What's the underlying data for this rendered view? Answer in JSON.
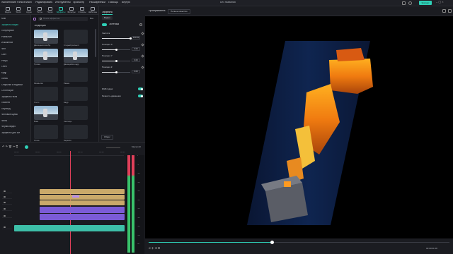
{
  "app": {
    "title": "Без названия",
    "menu": [
      "Wondershare Filmora",
      "Файл",
      "Редактировать",
      "Инструменты",
      "Просмотр",
      "Расширенный",
      "Помощь",
      "Внутри"
    ],
    "export_button": "Экспорт",
    "colors": {
      "accent": "#2fd0b7",
      "audio_green": "#39c26b",
      "audio_red": "#e0405a",
      "clip_gold": "#c9a96a",
      "clip_purple": "#7b5bd6",
      "clip_teal": "#3dbfa8"
    }
  },
  "toolbar": {
    "items": [
      {
        "label": "Медиа",
        "icon": "media-icon"
      },
      {
        "label": "Stock",
        "icon": "stock-icon"
      },
      {
        "label": "Аудио",
        "icon": "audio-icon"
      },
      {
        "label": "Титры",
        "icon": "titles-icon"
      },
      {
        "label": "Перех.",
        "icon": "transition-icon"
      },
      {
        "label": "Эффекты",
        "icon": "effects-icon"
      },
      {
        "label": "Фильтры",
        "icon": "filters-icon"
      },
      {
        "label": "Стикеры",
        "icon": "stickers-icon"
      },
      {
        "label": "Шаблоны",
        "icon": "templates-icon"
      }
    ],
    "active_index": 5
  },
  "categories": {
    "items": [
      "Мои",
      "Эффекты видео",
      "Популярное",
      "Размытие",
      "Искажение",
      "Фон",
      "Свет",
      "Ретро",
      "Глитч",
      "Кадр",
      "Линзы",
      "Открытки и подписи",
      "Сплитскрин",
      "Эффекты тела",
      "Пиксели",
      "Переход",
      "Фоновые шумы",
      "Фоны",
      "Формы видео",
      "Эффекты для ИИ"
    ],
    "selected_index": 1
  },
  "effects": {
    "search_placeholder": "Поиск эффектов",
    "filter_label": "Все",
    "section_title": "Тенденции",
    "items": [
      {
        "label": "Двоящееся изобр.",
        "thumb": "light"
      },
      {
        "label": "Старый фильм 2",
        "thumb": "dark"
      },
      {
        "label": "Тряска",
        "thumb": "light"
      },
      {
        "label": "Двоящийся кадр",
        "thumb": "light"
      },
      {
        "label": "Размытие",
        "thumb": "dark"
      },
      {
        "label": "Рамка",
        "thumb": "dark"
      },
      {
        "label": "Глитч",
        "thumb": "dark"
      },
      {
        "label": "Кадр",
        "thumb": "dark"
      },
      {
        "label": "Боке",
        "thumb": "light"
      },
      {
        "label": "Частицы",
        "thumb": "dark"
      },
      {
        "label": "Огонь",
        "thumb": "dark"
      },
      {
        "label": "Зеркало",
        "thumb": "dark"
      }
    ]
  },
  "properties": {
    "tab": "Эффекты",
    "subtab": "Видео",
    "effect_name": "Эстетика",
    "params": [
      {
        "label": "Частота",
        "value": "100.00",
        "fraction": 1.0
      },
      {
        "label": "Позиция X",
        "value": "0.00",
        "fraction": 0.5
      },
      {
        "label": "Позиция Y",
        "value": "0.00",
        "fraction": 0.5
      },
      {
        "label": "Позиция Z",
        "value": "0.00",
        "fraction": 0.5
      }
    ],
    "toggle1_label": "RGB Сдвиг",
    "toggle2_label": "Резкость движения",
    "reset_label": "Сброс"
  },
  "preview": {
    "tab1": "Проигрыватель",
    "quality": "Полное качество",
    "time_current": "00:00:01:08",
    "progress": 0.41
  },
  "timeline": {
    "zoom_label": "Масштаб",
    "ticks": [
      "00:00",
      "00:05",
      "00:10",
      "00:15",
      "00:20",
      "00:25"
    ],
    "meter_labels": [
      "0",
      "-6",
      "-12",
      "-18",
      "-24",
      "-30",
      "-36",
      "-42",
      "-48",
      "-54",
      "dB"
    ],
    "meter_lr": [
      "L",
      "R"
    ]
  }
}
